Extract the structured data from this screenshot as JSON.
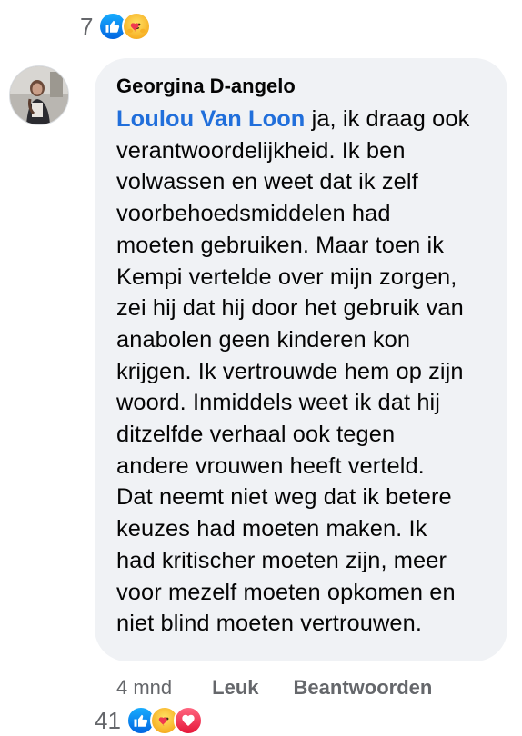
{
  "top_reactions": {
    "count": "7",
    "icons": [
      "like-icon",
      "care-icon"
    ]
  },
  "comment": {
    "author": "Georgina D-angelo",
    "mention": "Loulou Van Loon",
    "lines": [
      " ja, ik draag ook",
      "verantwoordelijkheid. Ik ben",
      "volwassen en weet dat ik zelf",
      "voorbehoedsmiddelen had",
      "moeten gebruiken. Maar toen ik",
      "Kempi vertelde over mijn zorgen,",
      "zei hij dat hij door het gebruik van",
      "anabolen geen kinderen kon",
      "krijgen. Ik vertrouwde hem op zijn",
      "woord. Inmiddels weet ik dat hij",
      "ditzelfde verhaal ook tegen",
      "andere vrouwen heeft verteld.",
      "Dat neemt niet weg dat ik betere",
      "keuzes had moeten maken. Ik",
      "had kritischer moeten zijn, meer",
      "voor mezelf moeten opkomen en",
      "niet blind moeten vertrouwen."
    ]
  },
  "actions": {
    "time": "4 mnd",
    "like_label": "Leuk",
    "reply_label": "Beantwoorden"
  },
  "bottom_reactions": {
    "count": "41",
    "icons": [
      "like-icon",
      "care-icon",
      "love-icon"
    ]
  },
  "colors": {
    "bubble_bg": "#f0f2f5",
    "mention": "#216fdb",
    "secondary_text": "#65676b",
    "like_blue": "#0866ff",
    "love_red": "#f33e58"
  }
}
